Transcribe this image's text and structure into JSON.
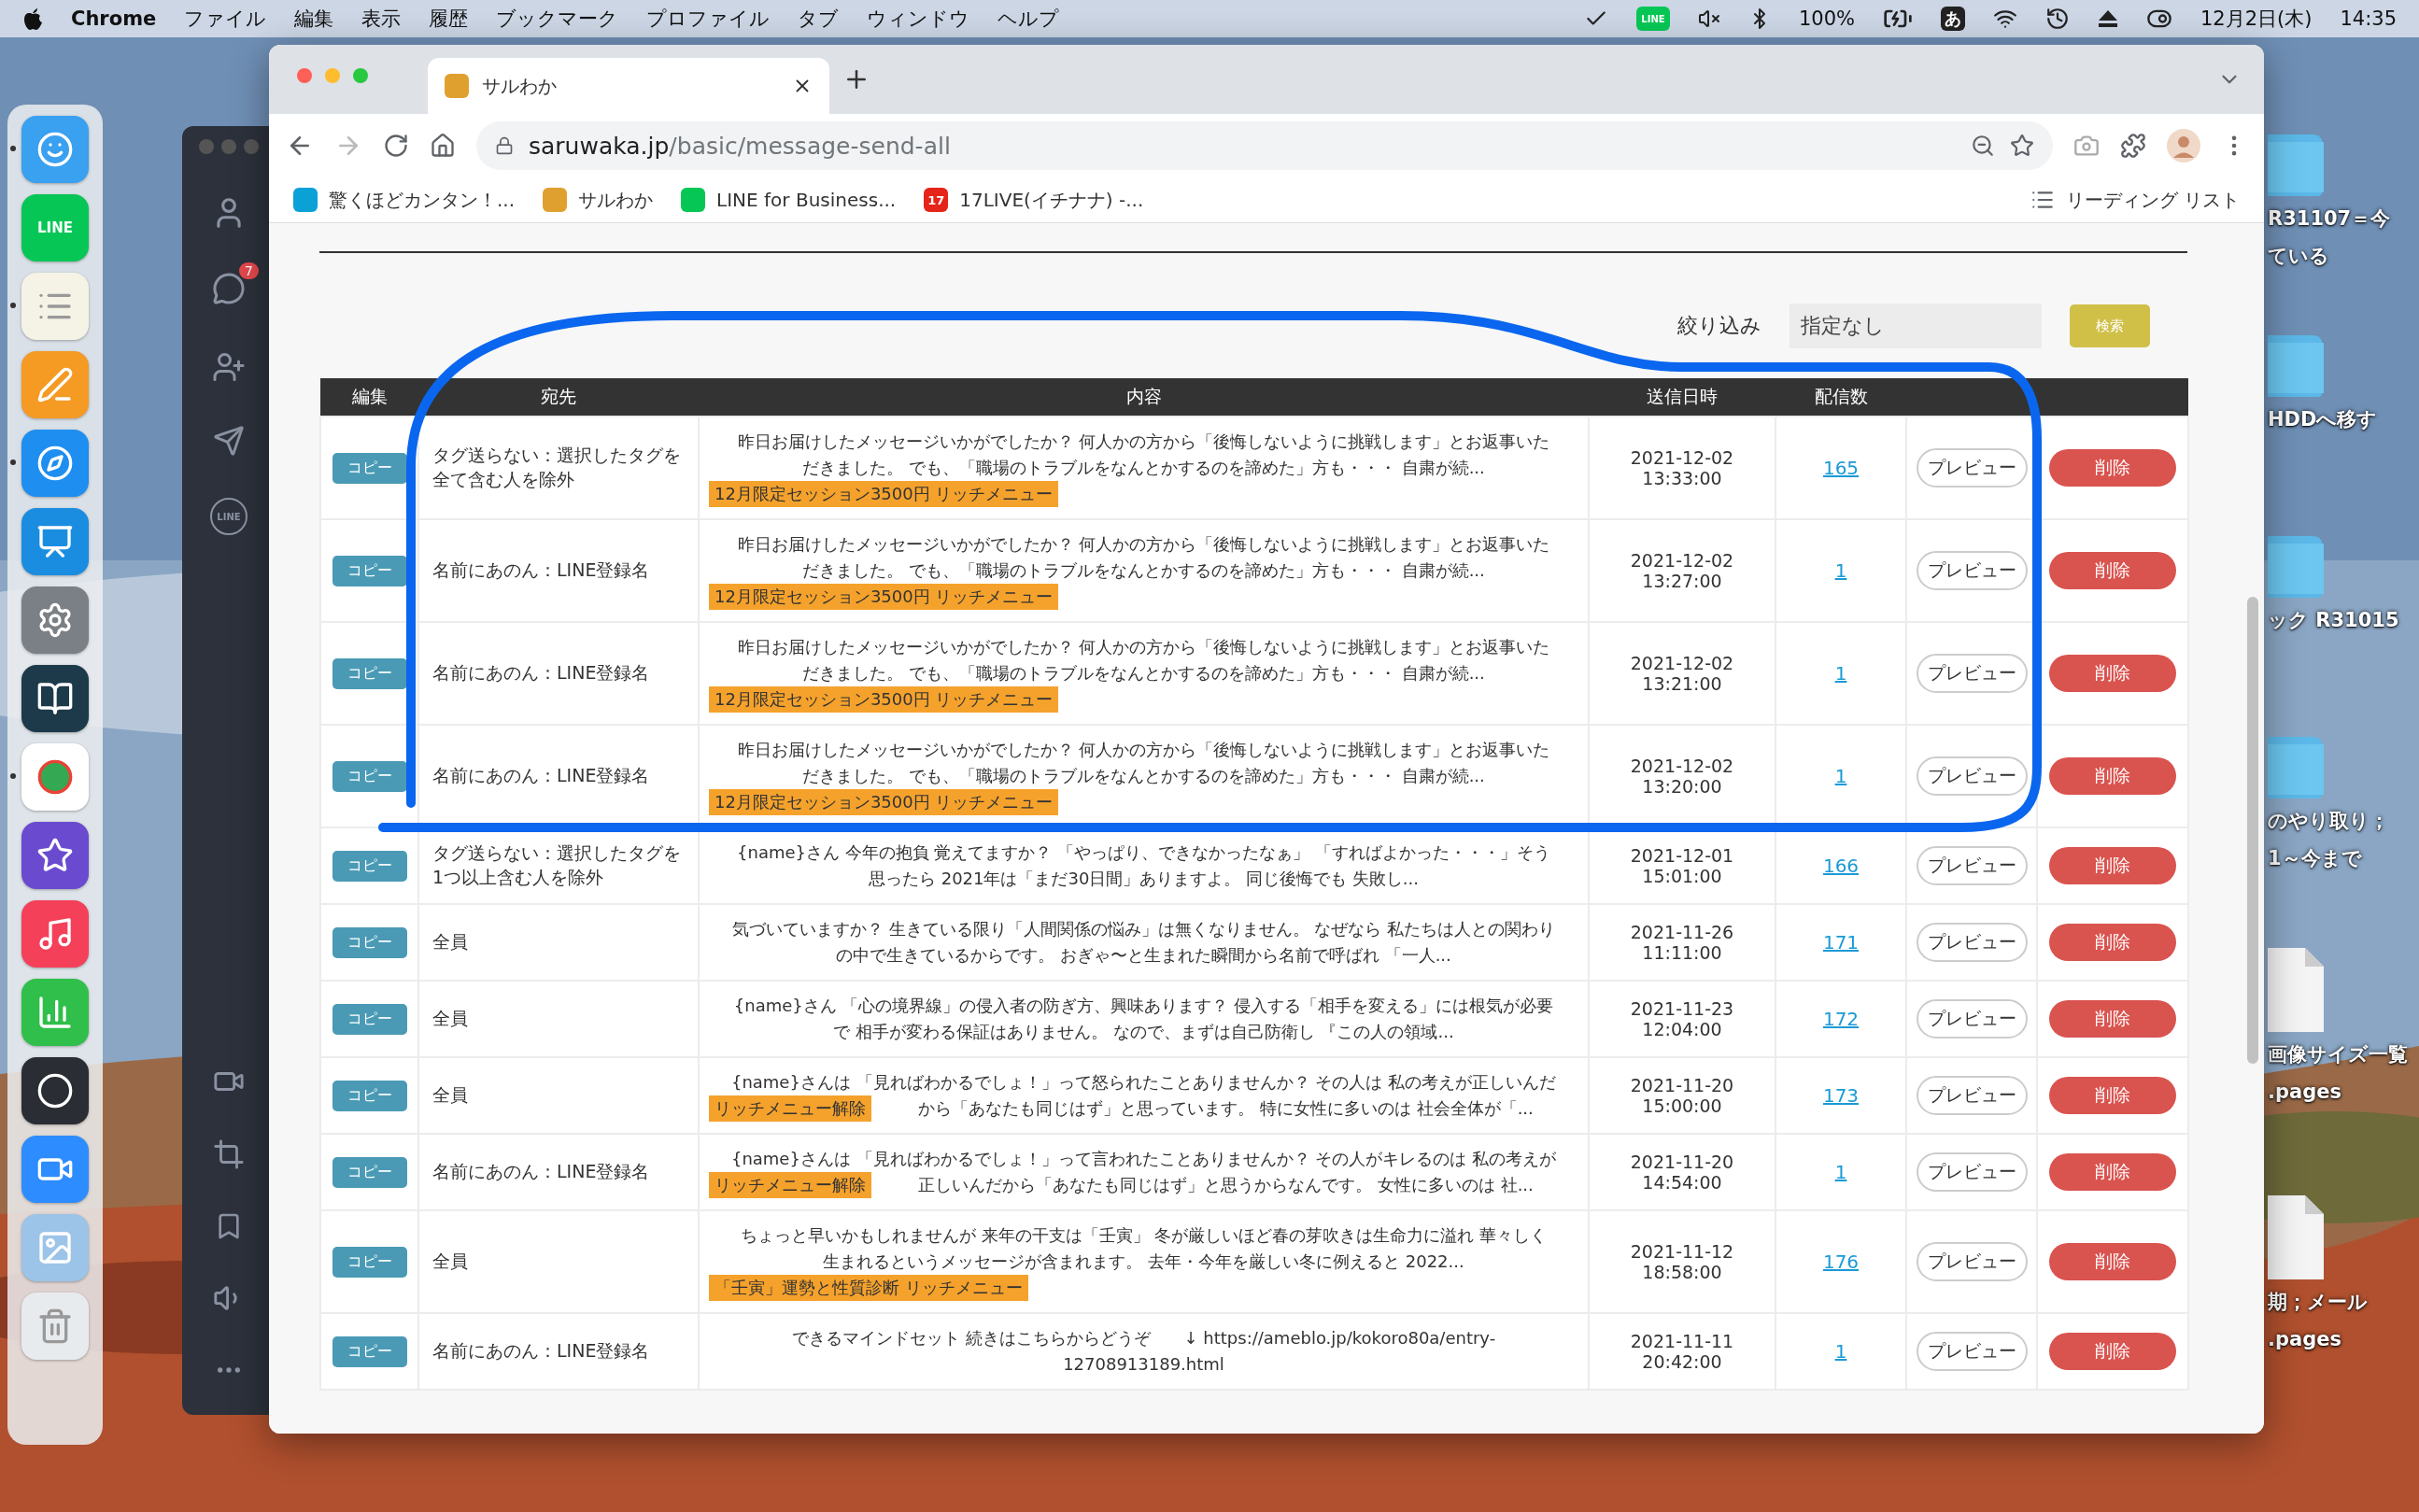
{
  "menu_bar": {
    "app": "Chrome",
    "menus": [
      "ファイル",
      "編集",
      "表示",
      "履歴",
      "ブックマーク",
      "プロファイル",
      "タブ",
      "ウィンドウ",
      "ヘルプ"
    ],
    "line_badge": "LINE",
    "battery": "100%",
    "input_mode": "あ",
    "date": "12月2日(木)",
    "time": "14:35"
  },
  "dock": [
    {
      "kind": "finder",
      "color": "#3aa0f0",
      "running": true
    },
    {
      "kind": "line",
      "color": "#06c755",
      "running": false,
      "label": "LINE"
    },
    {
      "kind": "notes",
      "color": "#f5f2e6",
      "running": true
    },
    {
      "kind": "pages",
      "color": "#f59a23",
      "running": false
    },
    {
      "kind": "safari",
      "color": "#1e8ef0",
      "running": true
    },
    {
      "kind": "keynote",
      "color": "#1a8de0",
      "running": false
    },
    {
      "kind": "settings",
      "color": "#7b7f86",
      "running": false
    },
    {
      "kind": "reader",
      "color": "#1d3a4a",
      "running": false
    },
    {
      "kind": "chrome",
      "color": "#ffffff",
      "running": true
    },
    {
      "kind": "imovie",
      "color": "#6a4bd0",
      "running": false
    },
    {
      "kind": "music",
      "color": "#f5405a",
      "running": false
    },
    {
      "kind": "numbers",
      "color": "#2fbf4a",
      "running": false
    },
    {
      "kind": "obs",
      "color": "#2a2d33",
      "running": false
    },
    {
      "kind": "zoom",
      "color": "#2d8cff",
      "running": false
    },
    {
      "kind": "preview",
      "color": "#9cc4e8",
      "running": false
    },
    {
      "kind": "trash",
      "color": "#e8ebee",
      "running": false
    }
  ],
  "side_app": {
    "badge": "7",
    "line_label": "LINE"
  },
  "browser": {
    "tab_title": "サルわか",
    "url_host": "saruwaka.jp",
    "url_path": "/basic/message-send-all",
    "bookmarks": [
      {
        "kind": "p",
        "label": "驚くほどカンタン！..."
      },
      {
        "kind": "monkey",
        "label": "サルわか"
      },
      {
        "kind": "line",
        "label": "LINE for Business..."
      },
      {
        "kind": "live",
        "label": "17LIVE(イチナナ) -...",
        "logo": "17"
      }
    ],
    "reading_list": "リーディング リスト"
  },
  "filter": {
    "label": "絞り込み",
    "value": "指定なし",
    "button": "検索"
  },
  "table": {
    "columns": [
      "編集",
      "宛先",
      "内容",
      "送信日時",
      "配信数"
    ],
    "rows": [
      {
        "kind": "below",
        "copy": "コピー",
        "recipient": "タグ送らない：選択したタグを全て含む人を除外",
        "content": [
          "昨日お届けしたメッセージいかがでしたか？ 何人かの方から「後悔しないように挑戦します」とお返事いた",
          "だきました。 でも、「職場のトラブルをなんとかするのを諦めた」方も・・・ 自粛が続..."
        ],
        "tag": "12月限定セッション3500円 リッチメニュー",
        "date": "2021-12-02",
        "time": "13:33:00",
        "count": "165",
        "preview": "プレビュー",
        "delete": "削除"
      },
      {
        "kind": "below",
        "copy": "コピー",
        "recipient": "名前にあのん：LINE登録名",
        "content": [
          "昨日お届けしたメッセージいかがでしたか？ 何人かの方から「後悔しないように挑戦します」とお返事いた",
          "だきました。 でも、「職場のトラブルをなんとかするのを諦めた」方も・・・ 自粛が続..."
        ],
        "tag": "12月限定セッション3500円 リッチメニュー",
        "date": "2021-12-02",
        "time": "13:27:00",
        "count": "1",
        "preview": "プレビュー",
        "delete": "削除"
      },
      {
        "kind": "below",
        "copy": "コピー",
        "recipient": "名前にあのん：LINE登録名",
        "content": [
          "昨日お届けしたメッセージいかがでしたか？ 何人かの方から「後悔しないように挑戦します」とお返事いた",
          "だきました。 でも、「職場のトラブルをなんとかするのを諦めた」方も・・・ 自粛が続..."
        ],
        "tag": "12月限定セッション3500円 リッチメニュー",
        "date": "2021-12-02",
        "time": "13:21:00",
        "count": "1",
        "preview": "プレビュー",
        "delete": "削除"
      },
      {
        "kind": "below",
        "copy": "コピー",
        "recipient": "名前にあのん：LINE登録名",
        "content": [
          "昨日お届けしたメッセージいかがでしたか？ 何人かの方から「後悔しないように挑戦します」とお返事いた",
          "だきました。 でも、「職場のトラブルをなんとかするのを諦めた」方も・・・ 自粛が続..."
        ],
        "tag": "12月限定セッション3500円 リッチメニュー",
        "date": "2021-12-02",
        "time": "13:20:00",
        "count": "1",
        "preview": "プレビュー",
        "delete": "削除"
      },
      {
        "kind": "plain",
        "copy": "コピー",
        "recipient": "タグ送らない：選択したタグを1つ以上含む人を除外",
        "content": [
          "{name}さん 今年の抱負 覚えてますか？ 「やっぱり、できなかったなぁ」 「すればよかった・・・」そう",
          "思ったら 2021年は「まだ30日間」ありますよ。 同じ後悔でも 失敗し..."
        ],
        "date": "2021-12-01",
        "time": "15:01:00",
        "count": "166",
        "preview": "プレビュー",
        "delete": "削除"
      },
      {
        "kind": "plain",
        "copy": "コピー",
        "recipient": "全員",
        "content": [
          "気づいていますか？ 生きている限り「人間関係の悩み」は無くなりません。 なぜなら 私たちは人との関わり",
          "の中で生きているからです。 おぎゃ〜と生まれた瞬間から名前で呼ばれ 「一人..."
        ],
        "date": "2021-11-26",
        "time": "11:11:00",
        "count": "171",
        "preview": "プレビュー",
        "delete": "削除"
      },
      {
        "kind": "plain",
        "copy": "コピー",
        "recipient": "全員",
        "content": [
          "{name}さん 「心の境界線」の侵入者の防ぎ方、興味あります？ 侵入する「相手を変える」には根気が必要",
          "で 相手が変わる保証はありません。 なので、まずは自己防衛し 『この人の領域..."
        ],
        "date": "2021-11-23",
        "time": "12:04:00",
        "count": "172",
        "preview": "プレビュー",
        "delete": "削除"
      },
      {
        "kind": "inline",
        "copy": "コピー",
        "recipient": "全員",
        "content": [
          "{name}さんは 「見ればわかるでしょ！」って怒られたことありませんか？ その人は 私の考えが正しいんだ",
          "から「あなたも同じはず」と思っています。 特に女性に多いのは 社会全体が「..."
        ],
        "tag": "リッチメニュー解除",
        "date": "2021-11-20",
        "time": "15:00:00",
        "count": "173",
        "preview": "プレビュー",
        "delete": "削除"
      },
      {
        "kind": "inline",
        "copy": "コピー",
        "recipient": "名前にあのん：LINE登録名",
        "content": [
          "{name}さんは 「見ればわかるでしょ！」って言われたことありませんか？ その人がキレるのは 私の考えが",
          "正しいんだから「あなたも同じはず」と思うからなんです。 女性に多いのは 社..."
        ],
        "tag": "リッチメニュー解除",
        "date": "2021-11-20",
        "time": "14:54:00",
        "count": "1",
        "preview": "プレビュー",
        "delete": "削除"
      },
      {
        "kind": "below",
        "copy": "コピー",
        "recipient": "全員",
        "content": [
          "ちょっと早いかもしれませんが 来年の干支は「壬寅」 冬が厳しいほど春の芽吹きは生命力に溢れ 華々しく",
          "生まれるというメッセージが含まれます。 去年・今年を厳しい冬に例えると 2022..."
        ],
        "tag": "「壬寅」運勢と性質診断 リッチメニュー",
        "date": "2021-11-12",
        "time": "18:58:00",
        "count": "176",
        "preview": "プレビュー",
        "delete": "削除"
      },
      {
        "kind": "plain",
        "copy": "コピー",
        "recipient": "名前にあのん：LINE登録名",
        "content": [
          "できるマインドセット 続きはこちらからどうぞ　　↓ https://ameblo.jp/kokoro80a/entry-",
          "12708913189.html"
        ],
        "date": "2021-11-11",
        "time": "20:42:00",
        "count": "1",
        "preview": "プレビュー",
        "delete": "削除"
      }
    ]
  },
  "desktop_items": [
    {
      "kind": "folder",
      "label": [
        "R31107＝今",
        "ている"
      ]
    },
    {
      "kind": "folder",
      "label": [
        "HDDへ移す"
      ]
    },
    {
      "kind": "folder",
      "label": [
        "ック R31015"
      ]
    },
    {
      "kind": "folder",
      "label": [
        "のやり取り；",
        "1～今まで"
      ]
    },
    {
      "kind": "document",
      "label": [
        "画像サイズ一覧",
        ".pages"
      ]
    },
    {
      "kind": "document",
      "label": [
        "期；メール",
        ".pages"
      ]
    }
  ]
}
